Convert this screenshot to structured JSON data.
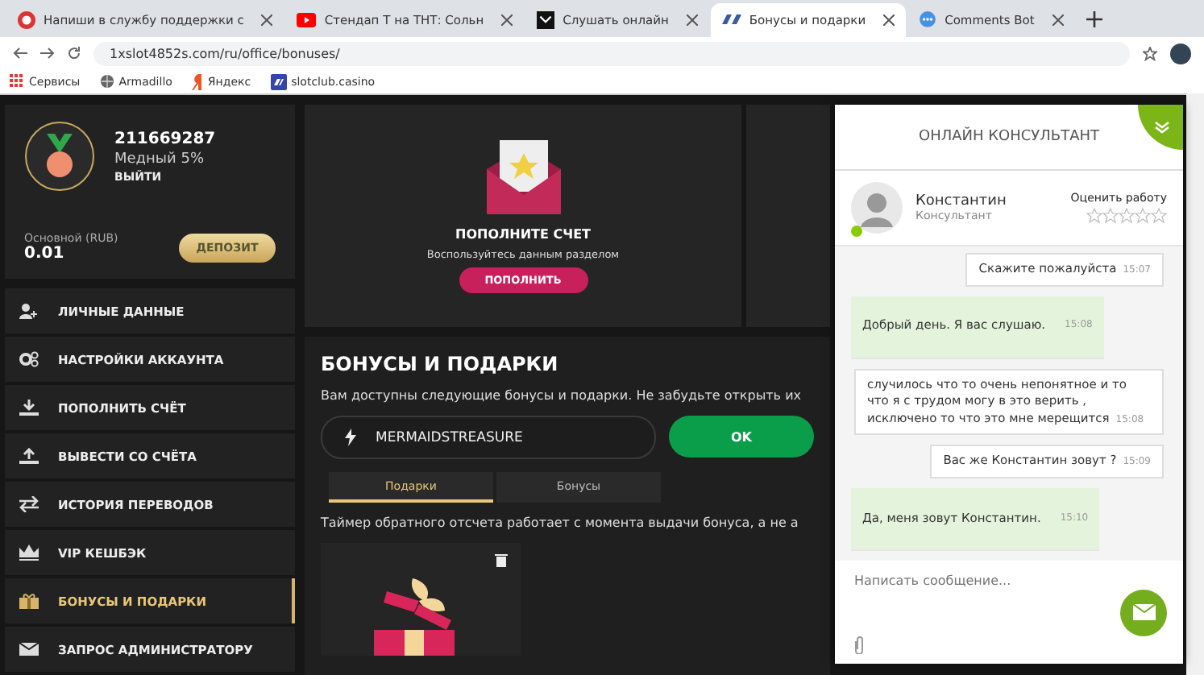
{
  "browser": {
    "tabs": [
      {
        "label": "Напиши в службу поддержки с",
        "selected": false,
        "kind": "support"
      },
      {
        "label": "Стендап Т на ТНТ: Сольн",
        "selected": false,
        "kind": "video"
      },
      {
        "label": "Слушать онлайн",
        "selected": false,
        "kind": "music"
      },
      {
        "label": "Бонусы и подарки",
        "selected": true,
        "kind": "site"
      },
      {
        "label": "Comments Bot",
        "selected": false,
        "kind": "chat"
      }
    ],
    "address": "1xslot4852s.com/ru/office/bonuses/",
    "bookmarks": [
      {
        "label": "Сервисы",
        "kind": "apps"
      },
      {
        "label": "Armadillo",
        "kind": "globe"
      },
      {
        "label": "Яндекс",
        "kind": "yandex"
      },
      {
        "label": "slotclub.casino",
        "kind": "site"
      }
    ]
  },
  "profile": {
    "id": "211669287",
    "level": "Медный 5%",
    "logout": "ВЫЙТИ",
    "balance_label": "Основной (RUB)",
    "balance": "0.01",
    "deposit": "ДЕПОЗИТ"
  },
  "menu": [
    {
      "label": "ЛИЧНЫЕ ДАННЫЕ",
      "kind": "user",
      "selected": false
    },
    {
      "label": "НАСТРОЙКИ АККАУНТА",
      "kind": "gears",
      "selected": false
    },
    {
      "label": "ПОПОЛНИТЬ СЧЁТ",
      "kind": "down",
      "selected": false
    },
    {
      "label": "ВЫВЕСТИ СО СЧЁТА",
      "kind": "up",
      "selected": false
    },
    {
      "label": "ИСТОРИЯ ПЕРЕВОДОВ",
      "kind": "swap",
      "selected": false
    },
    {
      "label": "VIP КЕШБЭК",
      "kind": "crown",
      "selected": false
    },
    {
      "label": "БОНУСЫ И ПОДАРКИ",
      "kind": "gift",
      "selected": true
    },
    {
      "label": "ЗАПРОС АДМИНИСТРАТОРУ",
      "kind": "mail",
      "selected": false
    }
  ],
  "promo_card": {
    "title": "ПОПОЛНИТЕ СЧЕТ",
    "subtitle": "Воспользуйтесь данным разделом",
    "button": "ПОПОЛНИТЬ"
  },
  "bonuses": {
    "title": "БОНУСЫ И ПОДАРКИ",
    "intro": "Вам доступны следующие бонусы и подарки. Не забудьте открыть их",
    "promo_code": "MERMAIDSTREASURE",
    "ok": "OK",
    "tabs": [
      {
        "label": "Подарки",
        "selected": true
      },
      {
        "label": "Бонусы",
        "selected": false
      }
    ],
    "timer_note": "Таймер обратного отсчета работает с момента выдачи бонуса, а не а"
  },
  "chat": {
    "title": "ОНЛАЙН КОНСУЛЬТАНТ",
    "agent": {
      "name": "Константин",
      "role": "Консультант",
      "online": true
    },
    "rate_label": "Оценить работу",
    "stars": 0,
    "messages": [
      {
        "kind": "user",
        "text": "Скажите пожалуйста",
        "time": "15:07"
      },
      {
        "kind": "agent",
        "text": "Добрый день. Я вас слушаю.",
        "time": "15:08"
      },
      {
        "kind": "user",
        "text": "случилось что то очень непонятное и то что я с трудом могу в это верить , исключено то что это мне мерещится",
        "time": "15:08"
      },
      {
        "kind": "user",
        "text": "Вас же Константин зовут ?",
        "time": "15:09"
      },
      {
        "kind": "agent",
        "text": "Да, меня зовут Константин.",
        "time": "15:10"
      }
    ],
    "placeholder": "Написать сообщение..."
  }
}
